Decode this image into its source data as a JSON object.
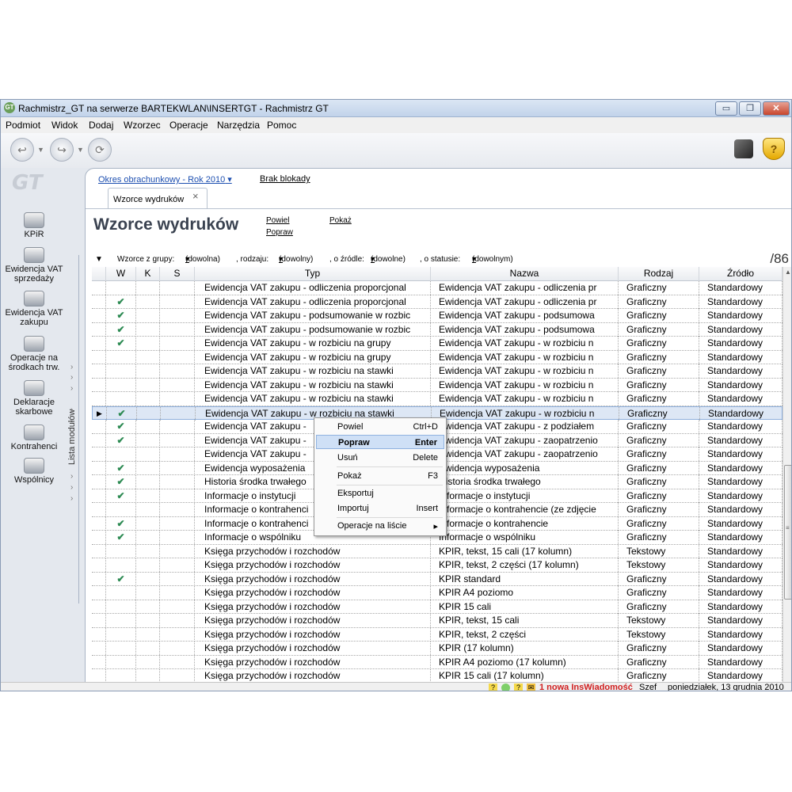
{
  "window": {
    "title": "Rachmistrz_GT na serwerze BARTEKWLAN\\INSERTGT - Rachmistrz GT",
    "app_icon": "GT"
  },
  "menu": {
    "items": [
      "Podmiot",
      "Widok",
      "Dodaj",
      "Wzorzec",
      "Operacje",
      "Narzędzia",
      "Pomoc"
    ]
  },
  "window_controls": {
    "minimize": "▭",
    "restore": "❐",
    "close": "✕"
  },
  "sidebar": {
    "logo": "GT",
    "modules": [
      {
        "label": "KPiR"
      },
      {
        "label": "Ewidencja VAT sprzedaży"
      },
      {
        "label": "Ewidencja VAT zakupu"
      },
      {
        "label": "Operacje na środkach trw."
      },
      {
        "label": "Deklaracje skarbowe"
      },
      {
        "label": "Kontrahenci"
      },
      {
        "label": "Wspólnicy"
      }
    ],
    "vertical_tab": "Lista modułów"
  },
  "panel": {
    "period": "Okres obrachunkowy - Rok 2010",
    "lock_status": "Brak blokady",
    "tab_label": "Wzorce wydruków",
    "title": "Wzorce wydruków",
    "actions": {
      "new": "Powiel",
      "show": "Pokaż",
      "fix": "Popraw"
    },
    "filter": {
      "group_label": "Wzorce z grupy:",
      "group_value": "(dowolna)",
      "kind_label": ", rodzaju:",
      "kind_value": "(dowolny)",
      "source_label": ", o źródle:",
      "source_value": "(dowolne)",
      "status_label": ", o statusie:",
      "status_value": "(dowolnym)"
    },
    "count": "/86"
  },
  "grid": {
    "columns": [
      "W",
      "K",
      "S",
      "Typ",
      "Nazwa",
      "Rodzaj",
      "Źródło"
    ],
    "rows": [
      {
        "w": "",
        "typ": "Ewidencja VAT zakupu - odliczenia proporcjonal",
        "nazwa": "Ewidencja VAT zakupu - odliczenia pr",
        "rodzaj": "Graficzny",
        "zrodlo": "Standardowy"
      },
      {
        "w": "✔",
        "typ": "Ewidencja VAT zakupu - odliczenia proporcjonal",
        "nazwa": "Ewidencja VAT zakupu - odliczenia pr",
        "rodzaj": "Graficzny",
        "zrodlo": "Standardowy"
      },
      {
        "w": "✔",
        "typ": "Ewidencja VAT zakupu - podsumowanie w rozbic",
        "nazwa": "Ewidencja VAT zakupu - podsumowa",
        "rodzaj": "Graficzny",
        "zrodlo": "Standardowy"
      },
      {
        "w": "✔",
        "typ": "Ewidencja VAT zakupu - podsumowanie w rozbic",
        "nazwa": "Ewidencja VAT zakupu - podsumowa",
        "rodzaj": "Graficzny",
        "zrodlo": "Standardowy"
      },
      {
        "w": "✔",
        "typ": "Ewidencja VAT zakupu - w rozbiciu na grupy",
        "nazwa": "Ewidencja VAT zakupu - w rozbiciu n",
        "rodzaj": "Graficzny",
        "zrodlo": "Standardowy"
      },
      {
        "w": "",
        "typ": "Ewidencja VAT zakupu - w rozbiciu na grupy",
        "nazwa": "Ewidencja VAT zakupu - w rozbiciu n",
        "rodzaj": "Graficzny",
        "zrodlo": "Standardowy"
      },
      {
        "w": "",
        "typ": "Ewidencja VAT zakupu - w rozbiciu na stawki",
        "nazwa": "Ewidencja VAT zakupu - w rozbiciu n",
        "rodzaj": "Graficzny",
        "zrodlo": "Standardowy"
      },
      {
        "w": "",
        "typ": "Ewidencja VAT zakupu - w rozbiciu na stawki",
        "nazwa": "Ewidencja VAT zakupu - w rozbiciu n",
        "rodzaj": "Graficzny",
        "zrodlo": "Standardowy"
      },
      {
        "w": "",
        "typ": "Ewidencja VAT zakupu - w rozbiciu na stawki",
        "nazwa": "Ewidencja VAT zakupu - w rozbiciu n",
        "rodzaj": "Graficzny",
        "zrodlo": "Standardowy"
      },
      {
        "w": "✔",
        "typ": "Ewidencja VAT zakupu - w rozbiciu na stawki",
        "nazwa": "Ewidencja VAT zakupu - w rozbiciu n",
        "rodzaj": "Graficzny",
        "zrodlo": "Standardowy",
        "selected": true
      },
      {
        "w": "✔",
        "typ": "Ewidencja VAT zakupu -",
        "nazwa": "Ewidencja VAT zakupu - z podziałem",
        "rodzaj": "Graficzny",
        "zrodlo": "Standardowy"
      },
      {
        "w": "✔",
        "typ": "Ewidencja VAT zakupu -",
        "nazwa": "Ewidencja VAT zakupu - zaopatrzenio",
        "rodzaj": "Graficzny",
        "zrodlo": "Standardowy"
      },
      {
        "w": "",
        "typ": "Ewidencja VAT zakupu -",
        "nazwa": "Ewidencja VAT zakupu - zaopatrzenio",
        "rodzaj": "Graficzny",
        "zrodlo": "Standardowy"
      },
      {
        "w": "✔",
        "typ": "Ewidencja wyposażenia",
        "nazwa": "Ewidencja wyposażenia",
        "rodzaj": "Graficzny",
        "zrodlo": "Standardowy"
      },
      {
        "w": "✔",
        "typ": "Historia środka trwałego",
        "nazwa": "Historia środka trwałego",
        "rodzaj": "Graficzny",
        "zrodlo": "Standardowy"
      },
      {
        "w": "✔",
        "typ": "Informacje o instytucji",
        "nazwa": "Informacje o instytucji",
        "rodzaj": "Graficzny",
        "zrodlo": "Standardowy"
      },
      {
        "w": "",
        "typ": "Informacje o kontrahenci",
        "nazwa": "Informacje o kontrahencie (ze zdjęcie",
        "rodzaj": "Graficzny",
        "zrodlo": "Standardowy"
      },
      {
        "w": "✔",
        "typ": "Informacje o kontrahenci",
        "nazwa": "Informacje o kontrahencie",
        "rodzaj": "Graficzny",
        "zrodlo": "Standardowy"
      },
      {
        "w": "✔",
        "typ": "Informacje o wspólniku",
        "nazwa": "Informacje o wspólniku",
        "rodzaj": "Graficzny",
        "zrodlo": "Standardowy"
      },
      {
        "w": "",
        "typ": "Księga przychodów i rozchodów",
        "nazwa": "KPIR, tekst, 15 cali (17 kolumn)",
        "rodzaj": "Tekstowy",
        "zrodlo": "Standardowy"
      },
      {
        "w": "",
        "typ": "Księga przychodów i rozchodów",
        "nazwa": "KPIR, tekst, 2 części (17 kolumn)",
        "rodzaj": "Tekstowy",
        "zrodlo": "Standardowy"
      },
      {
        "w": "✔",
        "typ": "Księga przychodów i rozchodów",
        "nazwa": "KPIR standard",
        "rodzaj": "Graficzny",
        "zrodlo": "Standardowy"
      },
      {
        "w": "",
        "typ": "Księga przychodów i rozchodów",
        "nazwa": "KPIR A4 poziomo",
        "rodzaj": "Graficzny",
        "zrodlo": "Standardowy"
      },
      {
        "w": "",
        "typ": "Księga przychodów i rozchodów",
        "nazwa": "KPIR 15 cali",
        "rodzaj": "Graficzny",
        "zrodlo": "Standardowy"
      },
      {
        "w": "",
        "typ": "Księga przychodów i rozchodów",
        "nazwa": "KPIR, tekst, 15 cali",
        "rodzaj": "Tekstowy",
        "zrodlo": "Standardowy"
      },
      {
        "w": "",
        "typ": "Księga przychodów i rozchodów",
        "nazwa": "KPIR, tekst, 2 części",
        "rodzaj": "Tekstowy",
        "zrodlo": "Standardowy"
      },
      {
        "w": "",
        "typ": "Księga przychodów i rozchodów",
        "nazwa": "KPIR (17 kolumn)",
        "rodzaj": "Graficzny",
        "zrodlo": "Standardowy"
      },
      {
        "w": "",
        "typ": "Księga przychodów i rozchodów",
        "nazwa": "KPIR A4 poziomo (17 kolumn)",
        "rodzaj": "Graficzny",
        "zrodlo": "Standardowy"
      },
      {
        "w": "",
        "typ": "Księga przychodów i rozchodów",
        "nazwa": "KPIR 15 cali (17 kolumn)",
        "rodzaj": "Graficzny",
        "zrodlo": "Standardowy"
      }
    ]
  },
  "context_menu": {
    "items": [
      {
        "label": "Powiel",
        "shortcut": "Ctrl+D"
      },
      {
        "label": "Popraw",
        "shortcut": "Enter",
        "bold": true,
        "highlight": true
      },
      {
        "label": "Usuń",
        "shortcut": "Delete"
      },
      {
        "label": "Pokaż",
        "shortcut": "F3"
      },
      {
        "label": "Eksportuj",
        "shortcut": ""
      },
      {
        "label": "Importuj",
        "shortcut": "Insert"
      },
      {
        "label": "Operacje na liście",
        "shortcut": "▸"
      }
    ]
  },
  "statusbar": {
    "message": "1 nowa InsWiadomość",
    "user": "Szef",
    "date": "poniedziałek, 13 grudnia 2010"
  },
  "colors": {
    "checkmark": "#2c8a52",
    "link": "#1d4fb0",
    "selection": "#dde7f5",
    "alert": "#d02020"
  }
}
